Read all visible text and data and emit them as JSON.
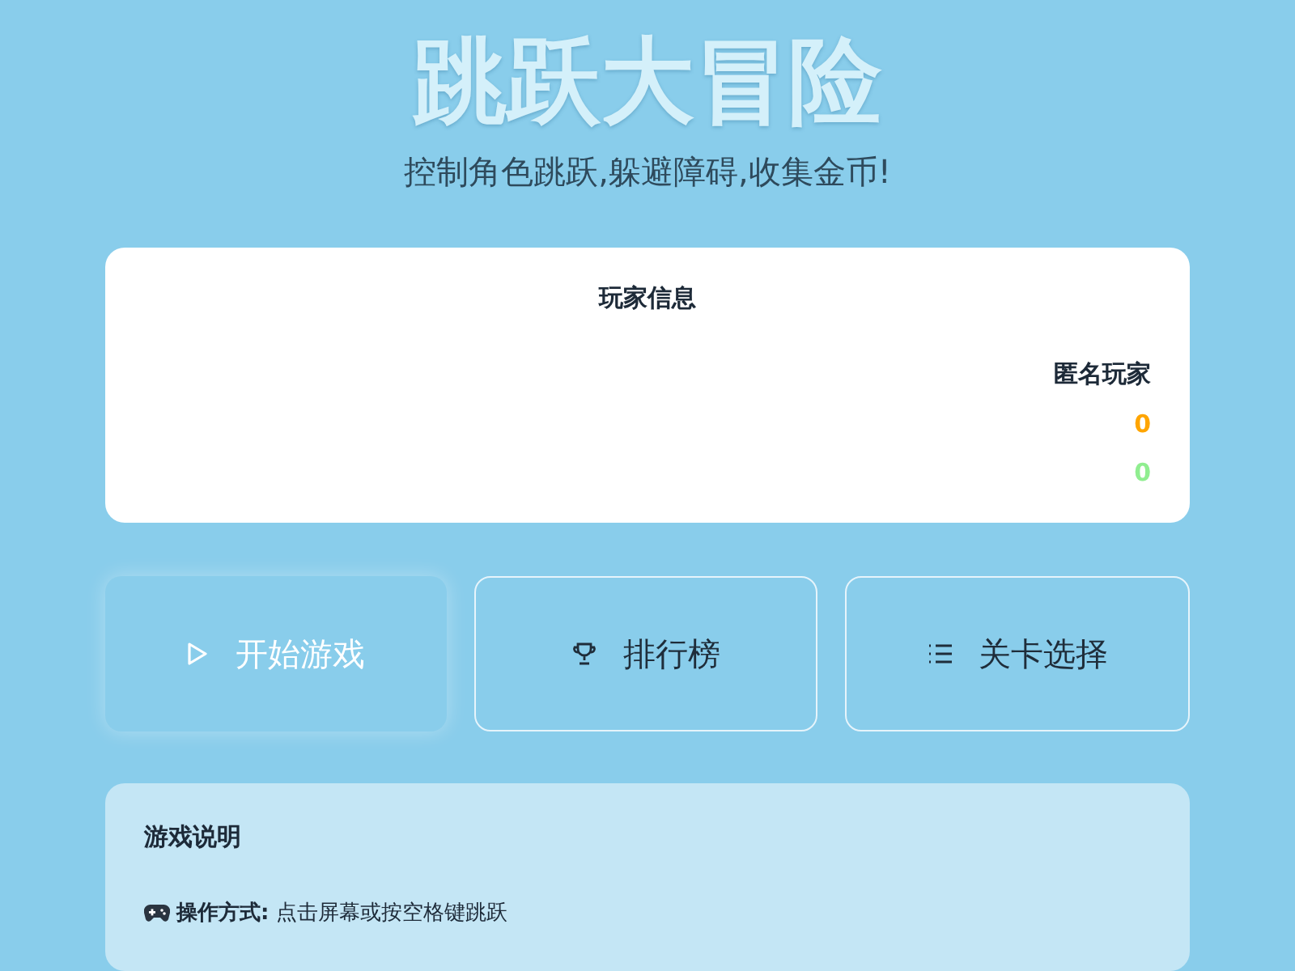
{
  "title": "跳跃大冒险",
  "subtitle": "控制角色跳跃,躲避障碍,收集金币!",
  "player_panel": {
    "heading": "玩家信息",
    "name": "匿名玩家",
    "stats": [
      {
        "value": "0",
        "color": "#ffa500"
      },
      {
        "value": "0",
        "color": "#90ee90"
      }
    ]
  },
  "buttons": [
    {
      "label": "开始游戏",
      "kind": "primary"
    },
    {
      "label": "排行榜",
      "kind": "outline"
    },
    {
      "label": "关卡选择",
      "kind": "outline"
    }
  ],
  "instructions": {
    "heading": "游戏说明",
    "items": [
      {
        "text": "**操作方式:** 点击屏幕或按空格键跳跃"
      }
    ]
  }
}
